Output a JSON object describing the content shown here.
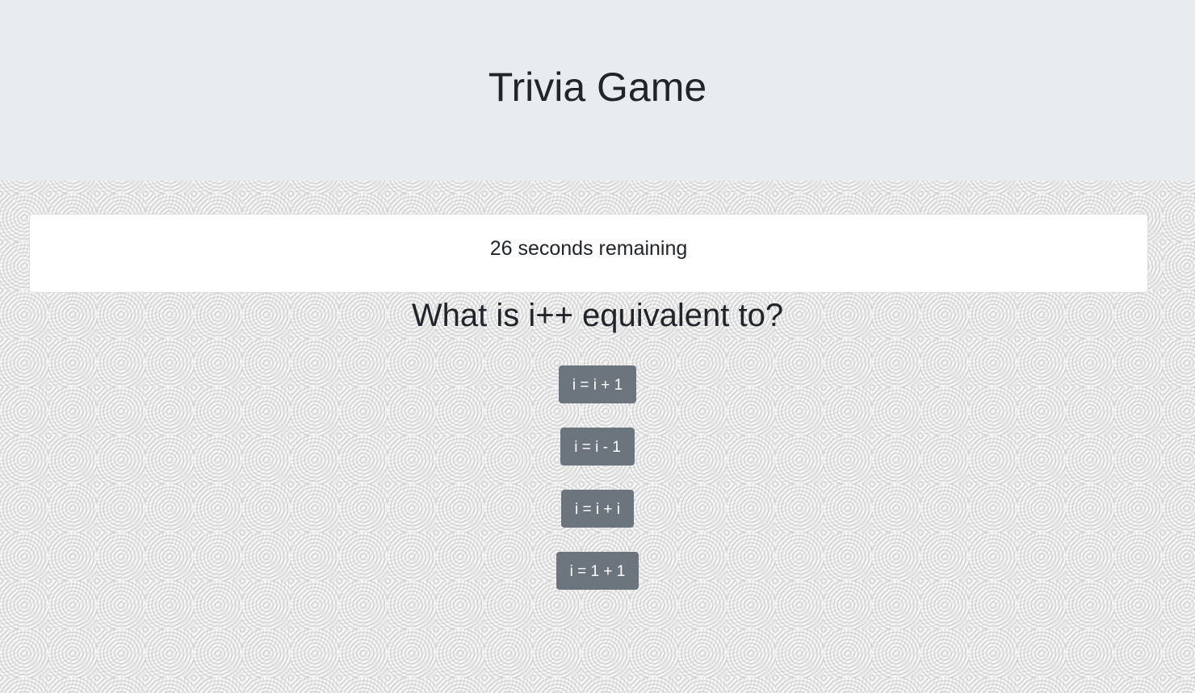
{
  "header": {
    "title": "Trivia Game"
  },
  "timer": {
    "text": "26 seconds remaining"
  },
  "question": {
    "text": "What is i++ equivalent to?"
  },
  "answers": [
    {
      "label": "i = i + 1"
    },
    {
      "label": "i = i - 1"
    },
    {
      "label": "i = i + i"
    },
    {
      "label": "i = 1 + 1"
    }
  ],
  "colors": {
    "header_bg": "#e9ecef",
    "button_bg": "#6c757d",
    "button_text": "#ffffff",
    "card_bg": "#ffffff"
  }
}
